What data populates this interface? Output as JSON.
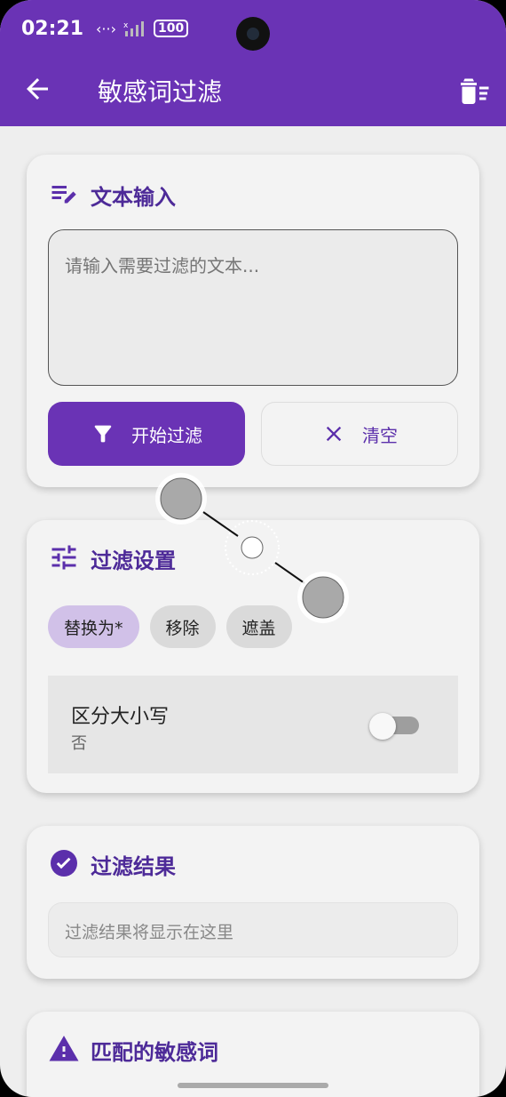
{
  "status_bar": {
    "time": "02:21",
    "signal_text": "<··>",
    "battery": "100"
  },
  "app_bar": {
    "title": "敏感词过滤",
    "back_icon": "arrow-back-icon",
    "delete_icon": "delete-sweep-icon"
  },
  "text_input_card": {
    "title": "文本输入",
    "icon": "edit-note-icon",
    "placeholder": "请输入需要过滤的文本...",
    "start_button": "开始过滤",
    "clear_button": "清空"
  },
  "settings_card": {
    "title": "过滤设置",
    "icon": "tune-icon",
    "modes": [
      "替换为*",
      "移除",
      "遮盖"
    ],
    "selected_mode": "替换为*",
    "case_sensitive": {
      "label": "区分大小写",
      "value": "否",
      "enabled": false
    }
  },
  "result_card": {
    "title": "过滤结果",
    "icon": "check-circle-icon",
    "placeholder": "过滤结果将显示在这里"
  },
  "matched_card": {
    "title": "匹配的敏感词",
    "icon": "warning-icon"
  },
  "colors": {
    "primary": "#6a33b5",
    "title_text": "#4d2a98",
    "background": "#eeeeee",
    "card": "#f3f3f3"
  }
}
